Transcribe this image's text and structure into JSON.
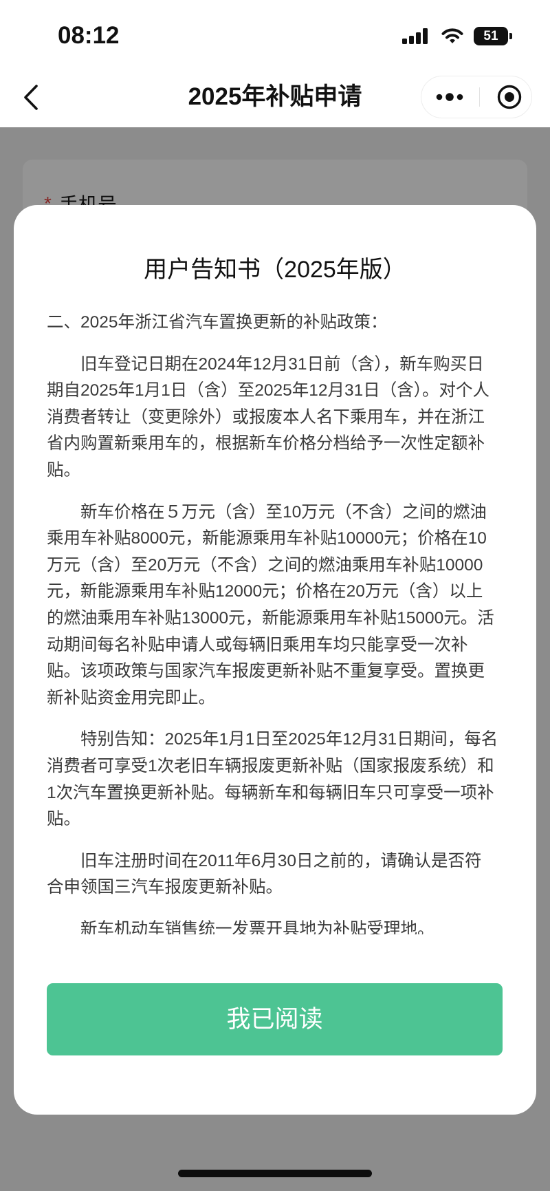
{
  "status_bar": {
    "time": "08:12",
    "battery_level": "51",
    "signal_icon": "cellular-signal-icon",
    "wifi_icon": "wifi-icon",
    "battery_icon": "battery-icon"
  },
  "nav_bar": {
    "title": "2025年补贴申请",
    "back_icon": "chevron-left-icon",
    "more_icon": "more-dots-icon",
    "close_icon": "target-circle-icon"
  },
  "form_behind": {
    "required_mark": "*",
    "phone_label": "手机号"
  },
  "notice_modal": {
    "title": "用户告知书（2025年版）",
    "section_heading": "二、2025年浙江省汽车置换更新的补贴政策：",
    "paragraphs": [
      {
        "lines": [
          "旧车登记日期在2024年12月31日前（含），新车购买日",
          "期自2025年1月1日（含）至2025年12月31日（含）。对个人",
          "消费者转让（变更除外）或报废本人名下乘用车，并在浙江",
          "省内购置新乘用车的，根据新车价格分档给予一次性定额补",
          "贴。"
        ]
      },
      {
        "lines": [
          "新车价格在５万元（含）至10万元（不含）之间的燃油",
          "乘用车补贴8000元，新能源乘用车补贴10000元；价格在10",
          "万元（含）至20万元（不含）之间的燃油乘用车补贴10000",
          "元，新能源乘用车补贴12000元；价格在20万元（含）以上",
          "的燃油乘用车补贴13000元，新能源乘用车补贴15000元。活",
          "动期间每名补贴申请人或每辆旧乘用车均只能享受一次补",
          "贴。该项政策与国家汽车报废更新补贴不重复享受。置换更",
          "新补贴资金用完即止。"
        ]
      },
      {
        "lines": [
          "特别告知：2025年1月1日至2025年12月31日期间，每名",
          "消费者可享受1次老旧车辆报废更新补贴（国家报废系统）和",
          "1次汽车置换更新补贴。每辆新车和每辆旧车只可享受一项补",
          "贴。"
        ]
      },
      {
        "lines": [
          "旧车注册时间在2011年6月30日之前的，请确认是否符",
          "合申领国三汽车报废更新补贴。"
        ]
      },
      {
        "lines": [
          "新车机动车销售统一发票开具地为补贴受理地。"
        ]
      }
    ],
    "confirm_button": "我已阅读"
  },
  "colors": {
    "accent_green": "#4dc493",
    "required_red": "#e64340"
  }
}
